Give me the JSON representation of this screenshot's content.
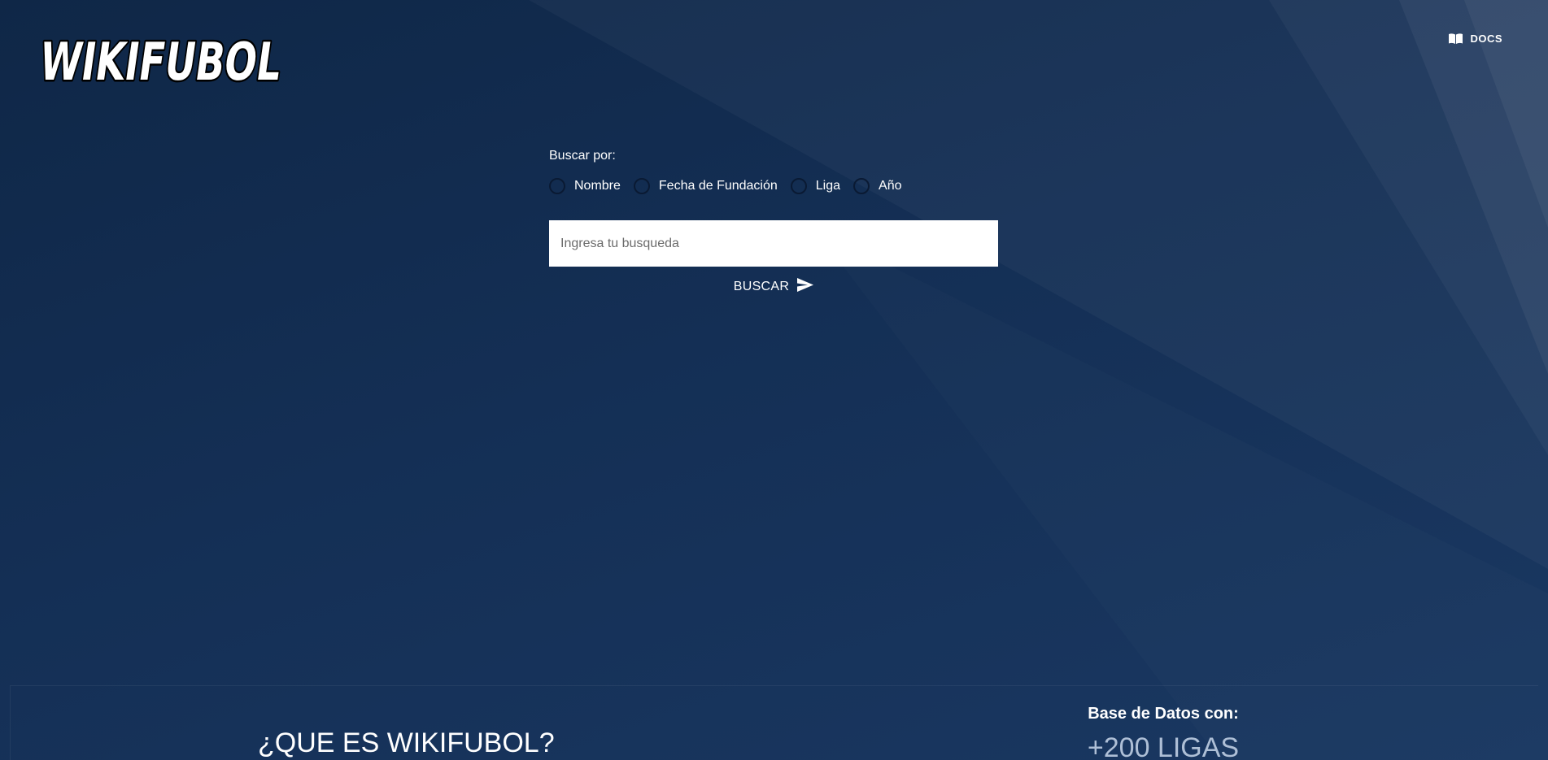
{
  "header": {
    "logo_text": "WIKIFUBOL",
    "docs_label": "DOCS",
    "docs_icon": "open-book-icon"
  },
  "search": {
    "label": "Buscar por:",
    "options": [
      {
        "label": "Nombre",
        "selected": false
      },
      {
        "label": "Fecha de Fundación",
        "selected": false
      },
      {
        "label": "Liga",
        "selected": false
      },
      {
        "label": "Año",
        "selected": false
      }
    ],
    "placeholder": "Ingresa tu busqueda",
    "value": "",
    "button_label": "BUSCAR",
    "button_icon": "send-icon"
  },
  "info": {
    "title": "¿QUE ES WIKIFUBOL?",
    "stats_heading": "Base de Datos con:",
    "stats_value": "+200 LIGAS"
  },
  "colors": {
    "background": "#122c4f",
    "text": "#ffffff",
    "stat_value": "#aebfd6",
    "radio_border": "#0a1a33"
  }
}
